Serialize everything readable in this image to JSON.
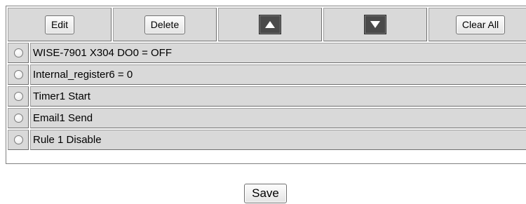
{
  "toolbar": {
    "edit_label": "Edit",
    "delete_label": "Delete",
    "up_icon": "triangle-up-icon",
    "down_icon": "triangle-down-icon",
    "clear_all_label": "Clear All"
  },
  "actions": [
    {
      "label": "WISE-7901 X304 DO0 = OFF",
      "selected": false
    },
    {
      "label": "Internal_register6 = 0",
      "selected": false
    },
    {
      "label": "Timer1 Start",
      "selected": false
    },
    {
      "label": "Email1 Send",
      "selected": false
    },
    {
      "label": "Rule 1 Disable",
      "selected": false
    }
  ],
  "footer": {
    "save_label": "Save"
  },
  "colors": {
    "cell_background": "#d9d9d9",
    "arrow_button": "#4a4a4a"
  }
}
